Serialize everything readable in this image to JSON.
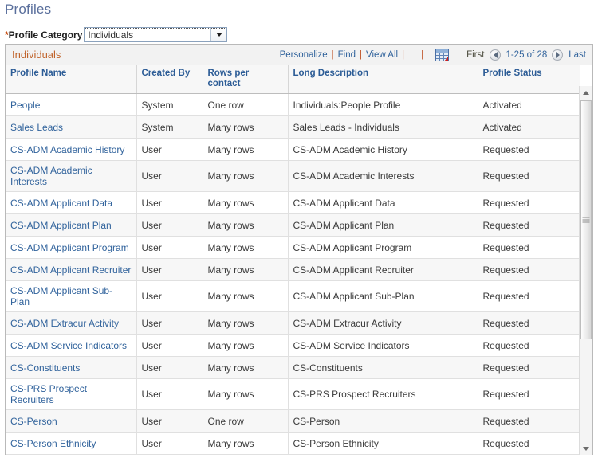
{
  "page": {
    "title": "Profiles"
  },
  "category": {
    "label": "Profile Category",
    "required_marker": "*",
    "selected": "Individuals",
    "options": [
      "Individuals"
    ]
  },
  "grid": {
    "band_title": "Individuals",
    "toolbar": {
      "personalize": "Personalize",
      "find": "Find",
      "view_all": "View All",
      "separator": "|",
      "download_icon": "spreadsheet-download-icon"
    },
    "pager": {
      "first": "First",
      "prev_icon": "left-arrow-icon",
      "range": "1-25 of 28",
      "next_icon": "right-arrow-icon",
      "last": "Last"
    },
    "columns": [
      "Profile Name",
      "Created By",
      "Rows per contact",
      "Long Description",
      "Profile Status"
    ],
    "rows": [
      {
        "name": "People",
        "created_by": "System",
        "rows_per_contact": "One row",
        "long_description": "Individuals:People Profile",
        "status": "Activated"
      },
      {
        "name": "Sales Leads",
        "created_by": "System",
        "rows_per_contact": "Many rows",
        "long_description": "Sales Leads - Individuals",
        "status": "Activated"
      },
      {
        "name": "CS-ADM Academic History",
        "created_by": "User",
        "rows_per_contact": "Many rows",
        "long_description": "CS-ADM Academic History",
        "status": "Requested"
      },
      {
        "name": "CS-ADM Academic Interests",
        "created_by": "User",
        "rows_per_contact": "Many rows",
        "long_description": "CS-ADM Academic Interests",
        "status": "Requested"
      },
      {
        "name": "CS-ADM Applicant Data",
        "created_by": "User",
        "rows_per_contact": "Many rows",
        "long_description": "CS-ADM Applicant Data",
        "status": "Requested"
      },
      {
        "name": "CS-ADM Applicant Plan",
        "created_by": "User",
        "rows_per_contact": "Many rows",
        "long_description": "CS-ADM Applicant Plan",
        "status": "Requested"
      },
      {
        "name": "CS-ADM Applicant Program",
        "created_by": "User",
        "rows_per_contact": "Many rows",
        "long_description": "CS-ADM Applicant Program",
        "status": "Requested"
      },
      {
        "name": "CS-ADM Applicant Recruiter",
        "created_by": "User",
        "rows_per_contact": "Many rows",
        "long_description": "CS-ADM Applicant Recruiter",
        "status": "Requested"
      },
      {
        "name": "CS-ADM Applicant Sub-Plan",
        "created_by": "User",
        "rows_per_contact": "Many rows",
        "long_description": "CS-ADM Applicant Sub-Plan",
        "status": "Requested"
      },
      {
        "name": "CS-ADM Extracur Activity",
        "created_by": "User",
        "rows_per_contact": "Many rows",
        "long_description": "CS-ADM Extracur Activity",
        "status": "Requested"
      },
      {
        "name": "CS-ADM Service Indicators",
        "created_by": "User",
        "rows_per_contact": "Many rows",
        "long_description": "CS-ADM Service Indicators",
        "status": "Requested"
      },
      {
        "name": "CS-Constituents",
        "created_by": "User",
        "rows_per_contact": "Many rows",
        "long_description": "CS-Constituents",
        "status": "Requested"
      },
      {
        "name": "CS-PRS Prospect Recruiters",
        "created_by": "User",
        "rows_per_contact": "Many rows",
        "long_description": "CS-PRS Prospect Recruiters",
        "status": "Requested"
      },
      {
        "name": "CS-Person",
        "created_by": "User",
        "rows_per_contact": "One row",
        "long_description": "CS-Person",
        "status": "Requested"
      },
      {
        "name": "CS-Person Ethnicity",
        "created_by": "User",
        "rows_per_contact": "Many rows",
        "long_description": "CS-Person Ethnicity",
        "status": "Requested"
      }
    ]
  },
  "colors": {
    "link": "#31639c",
    "band_title": "#c0632a",
    "page_title": "#5a6f9c",
    "separator": "#c0562a",
    "required": "#c44405"
  }
}
